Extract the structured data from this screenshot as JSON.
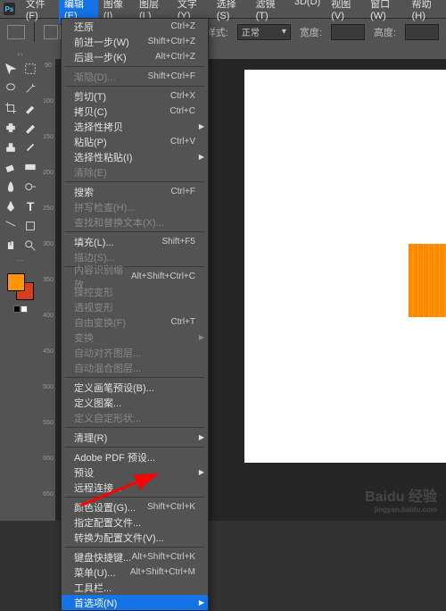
{
  "app": {
    "logo": "Ps"
  },
  "menubar": [
    {
      "label": "文件(F)"
    },
    {
      "label": "编辑(E)",
      "active": true
    },
    {
      "label": "图像(I)"
    },
    {
      "label": "图层(L)"
    },
    {
      "label": "文字(Y)"
    },
    {
      "label": "选择(S)"
    },
    {
      "label": "滤镜(T)"
    },
    {
      "label": "3D(D)"
    },
    {
      "label": "视图(V)"
    },
    {
      "label": "窗口(W)"
    },
    {
      "label": "帮助(H)"
    }
  ],
  "optionsbar": {
    "style_label": "样式:",
    "style_value": "正常",
    "width_label": "宽度:",
    "height_label": "高度:"
  },
  "swatches": {
    "fg": "#ff9500",
    "bg": "#d63f1a"
  },
  "ruler_ticks": [
    "50",
    "100",
    "150",
    "200",
    "250",
    "300",
    "350",
    "400",
    "450",
    "500",
    "550",
    "600",
    "650"
  ],
  "dropdown": [
    {
      "label": "还原",
      "shortcut": "Ctrl+Z"
    },
    {
      "label": "前进一步(W)",
      "shortcut": "Shift+Ctrl+Z"
    },
    {
      "label": "后退一步(K)",
      "shortcut": "Alt+Ctrl+Z"
    },
    {
      "sep": true
    },
    {
      "label": "渐隐(D)...",
      "shortcut": "Shift+Ctrl+F",
      "disabled": true
    },
    {
      "sep": true
    },
    {
      "label": "剪切(T)",
      "shortcut": "Ctrl+X"
    },
    {
      "label": "拷贝(C)",
      "shortcut": "Ctrl+C"
    },
    {
      "label": "选择性拷贝",
      "submenu": true
    },
    {
      "label": "粘贴(P)",
      "shortcut": "Ctrl+V"
    },
    {
      "label": "选择性粘贴(I)",
      "submenu": true
    },
    {
      "label": "清除(E)",
      "disabled": true
    },
    {
      "sep": true
    },
    {
      "label": "搜索",
      "shortcut": "Ctrl+F"
    },
    {
      "label": "拼写检查(H)...",
      "disabled": true
    },
    {
      "label": "查找和替换文本(X)...",
      "disabled": true
    },
    {
      "sep": true
    },
    {
      "label": "填充(L)...",
      "shortcut": "Shift+F5"
    },
    {
      "label": "描边(S)...",
      "disabled": true
    },
    {
      "sep": true
    },
    {
      "label": "内容识别缩放",
      "shortcut": "Alt+Shift+Ctrl+C",
      "disabled": true
    },
    {
      "label": "操控变形",
      "disabled": true
    },
    {
      "label": "透视变形",
      "disabled": true
    },
    {
      "label": "自由变换(F)",
      "shortcut": "Ctrl+T",
      "disabled": true
    },
    {
      "label": "变换",
      "submenu": true,
      "disabled": true
    },
    {
      "label": "自动对齐图层...",
      "disabled": true
    },
    {
      "label": "自动混合图层...",
      "disabled": true
    },
    {
      "sep": true
    },
    {
      "label": "定义画笔预设(B)..."
    },
    {
      "label": "定义图案..."
    },
    {
      "label": "定义自定形状...",
      "disabled": true
    },
    {
      "sep": true
    },
    {
      "label": "清理(R)",
      "submenu": true
    },
    {
      "sep": true
    },
    {
      "label": "Adobe PDF 预设..."
    },
    {
      "label": "预设",
      "submenu": true
    },
    {
      "label": "远程连接..."
    },
    {
      "sep": true
    },
    {
      "label": "颜色设置(G)...",
      "shortcut": "Shift+Ctrl+K"
    },
    {
      "label": "指定配置文件..."
    },
    {
      "label": "转换为配置文件(V)..."
    },
    {
      "sep": true
    },
    {
      "label": "键盘快捷键...",
      "shortcut": "Alt+Shift+Ctrl+K"
    },
    {
      "label": "菜单(U)...",
      "shortcut": "Alt+Shift+Ctrl+M"
    },
    {
      "label": "工具栏..."
    },
    {
      "label": "首选项(N)",
      "submenu": true,
      "highlight": true
    }
  ],
  "watermark": {
    "main": "Baidu 经验",
    "sub": "jingyan.baidu.com"
  }
}
